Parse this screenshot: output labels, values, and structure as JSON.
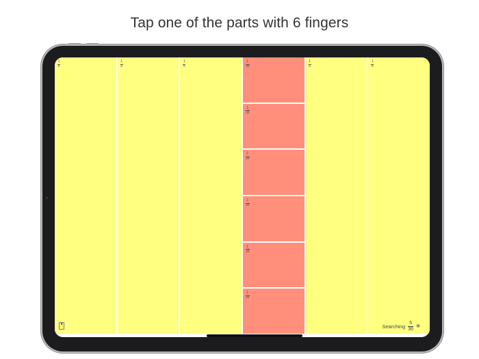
{
  "headline": "Tap one of the parts with 6 fingers",
  "columns": [
    {
      "num": "1",
      "den": "6"
    },
    {
      "num": "1",
      "den": "6"
    },
    {
      "num": "1",
      "den": "6"
    },
    {
      "num": "1",
      "den": "36",
      "cells": [
        {
          "num": "1",
          "den": "36"
        },
        {
          "num": "1",
          "den": "36"
        },
        {
          "num": "1",
          "den": "36"
        },
        {
          "num": "1",
          "den": "36"
        },
        {
          "num": "1",
          "den": "36"
        },
        {
          "num": "1",
          "den": "36"
        }
      ]
    },
    {
      "num": "1",
      "den": "6"
    },
    {
      "num": "1",
      "den": "6"
    }
  ],
  "status": {
    "label": "Searching",
    "num": "5",
    "den": "36"
  },
  "corner_button": "■",
  "settings_glyph": "✻",
  "colors": {
    "whole_part": "#ffff80",
    "sub_part": "#ff8f7a"
  }
}
